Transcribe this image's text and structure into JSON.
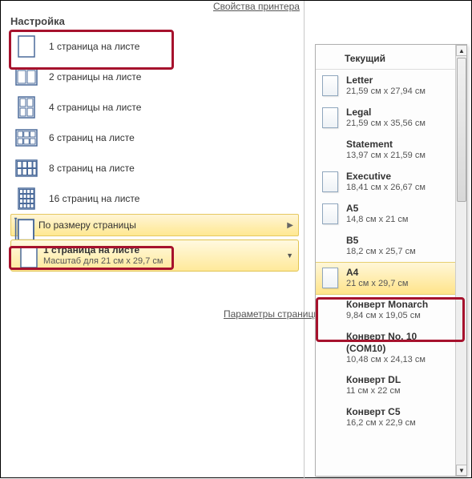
{
  "top_link": "Свойства принтера",
  "section_title": "Настройка",
  "pages_per_sheet": {
    "items": [
      {
        "label": "1 страница на листе"
      },
      {
        "label": "2 страницы на листе"
      },
      {
        "label": "4 страницы на листе"
      },
      {
        "label": "6 страниц на листе"
      },
      {
        "label": "8 страниц на листе"
      },
      {
        "label": "16 страниц на листе"
      }
    ],
    "scale_to_size_label": "По размеру страницы"
  },
  "combo": {
    "line1": "1 страница на листе",
    "line2": "Масштаб для 21 см x 29,7 см"
  },
  "page_params_link": "Параметры страницы",
  "flyout": {
    "header": "Текущий",
    "sizes": [
      {
        "name": "Letter",
        "dims": "21,59 см x 27,94 см",
        "icon": true
      },
      {
        "name": "Legal",
        "dims": "21,59 см x 35,56 см",
        "icon": true
      },
      {
        "name": "Statement",
        "dims": "13,97 см x 21,59 см",
        "icon": false
      },
      {
        "name": "Executive",
        "dims": "18,41 см x 26,67 см",
        "icon": true
      },
      {
        "name": "A5",
        "dims": "14,8 см x 21 см",
        "icon": true
      },
      {
        "name": "B5",
        "dims": "18,2 см x 25,7 см",
        "icon": false
      },
      {
        "name": "A4",
        "dims": "21 см x 29,7 см",
        "icon": true,
        "selected": true
      },
      {
        "name": "Конверт Monarch",
        "dims": "9,84 см x 19,05 см",
        "icon": false
      },
      {
        "name": "Конверт No. 10 (COM10)",
        "dims": "10,48 см x 24,13 см",
        "icon": false
      },
      {
        "name": "Конверт DL",
        "dims": "11 см x 22 см",
        "icon": false
      },
      {
        "name": "Конверт C5",
        "dims": "16,2 см x 22,9 см",
        "icon": false
      }
    ]
  }
}
